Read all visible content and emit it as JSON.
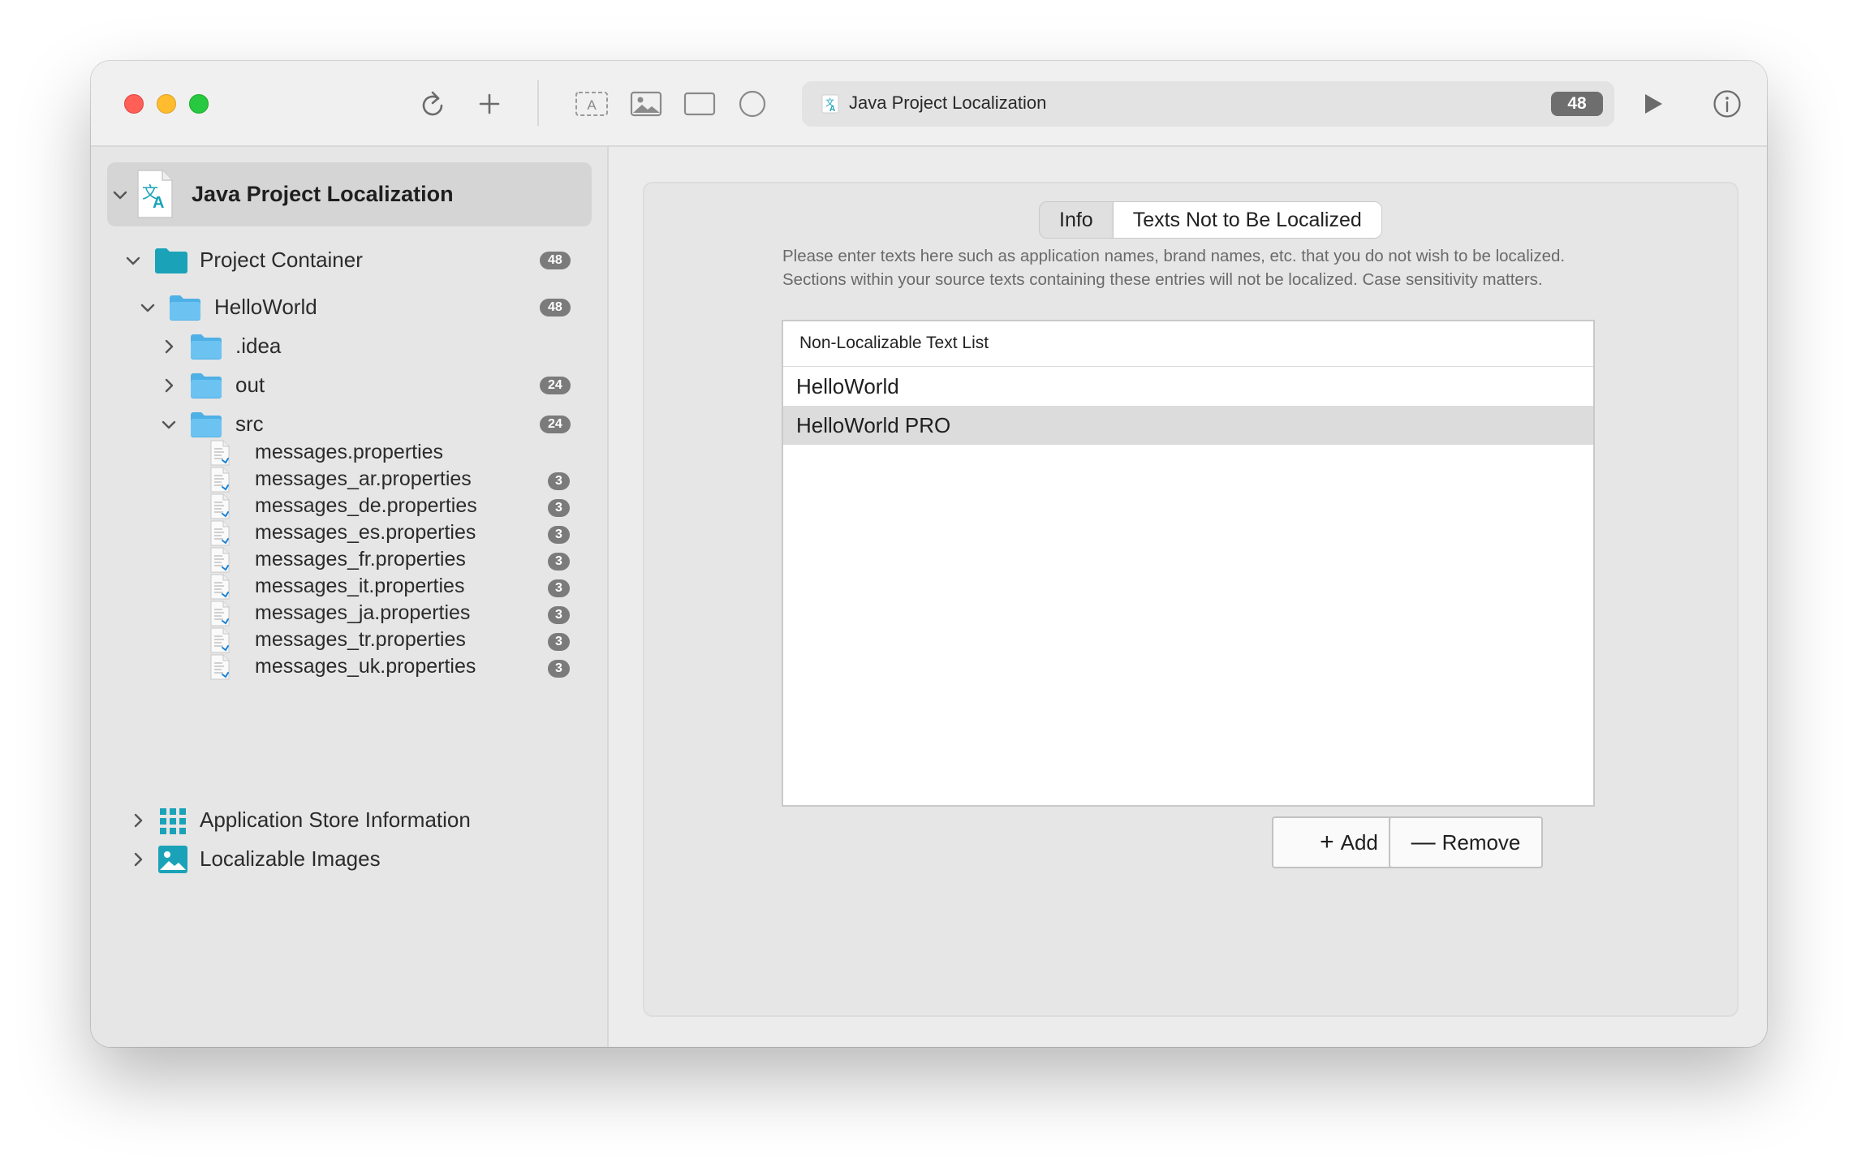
{
  "toolbar": {
    "title": "Java Project Localization",
    "badge": "48",
    "icons": [
      "refresh-icon",
      "plus-icon",
      "text-box-icon",
      "image-icon",
      "rectangle-icon",
      "circle-icon",
      "play-icon",
      "info-icon"
    ]
  },
  "sidebar": {
    "root": {
      "label": "Java Project Localization"
    },
    "project_container": {
      "label": "Project Container",
      "badge": "48"
    },
    "helloworld": {
      "label": "HelloWorld",
      "badge": "48"
    },
    "idea": {
      "label": ".idea"
    },
    "out": {
      "label": "out",
      "badge": "24"
    },
    "src": {
      "label": "src",
      "badge": "24"
    },
    "files": [
      {
        "label": "messages.properties",
        "badge": ""
      },
      {
        "label": "messages_ar.properties",
        "badge": "3"
      },
      {
        "label": "messages_de.properties",
        "badge": "3"
      },
      {
        "label": "messages_es.properties",
        "badge": "3"
      },
      {
        "label": "messages_fr.properties",
        "badge": "3"
      },
      {
        "label": "messages_it.properties",
        "badge": "3"
      },
      {
        "label": "messages_ja.properties",
        "badge": "3"
      },
      {
        "label": "messages_tr.properties",
        "badge": "3"
      },
      {
        "label": "messages_uk.properties",
        "badge": "3"
      }
    ],
    "app_store": {
      "label": "Application Store Information"
    },
    "images": {
      "label": "Localizable Images"
    }
  },
  "main": {
    "tabs": [
      {
        "label": "Info",
        "active": false
      },
      {
        "label": "Texts Not to Be Localized",
        "active": true
      }
    ],
    "description": "Please enter texts here such as application names, brand names, etc. that you do not wish to be localized. Sections within your source texts containing these entries will not be localized. Case sensitivity matters.",
    "list": {
      "header": "Non-Localizable Text List",
      "items": [
        {
          "text": "HelloWorld",
          "selected": false
        },
        {
          "text": "HelloWorld PRO",
          "selected": true
        }
      ]
    },
    "add_label": "Add",
    "remove_label": "Remove"
  },
  "colors": {
    "accent_teal": "#1aa3b8",
    "folder_blue": "#5ab8ec",
    "badge_gray": "#7b7b7b",
    "selection_gray": "#dcdcdc"
  }
}
